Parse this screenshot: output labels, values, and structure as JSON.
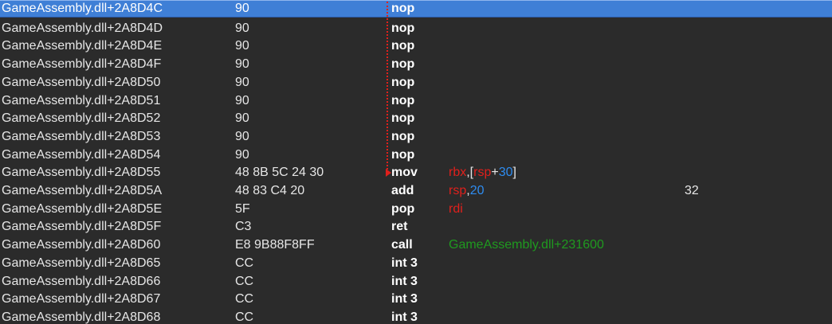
{
  "rows": [
    {
      "addr": "GameAssembly.dll+2A8D4C",
      "bytes": "90",
      "op": "nop",
      "args": [],
      "comment": ""
    },
    {
      "addr": "GameAssembly.dll+2A8D4D",
      "bytes": "90",
      "op": "nop",
      "args": [],
      "comment": ""
    },
    {
      "addr": "GameAssembly.dll+2A8D4E",
      "bytes": "90",
      "op": "nop",
      "args": [],
      "comment": ""
    },
    {
      "addr": "GameAssembly.dll+2A8D4F",
      "bytes": "90",
      "op": "nop",
      "args": [],
      "comment": ""
    },
    {
      "addr": "GameAssembly.dll+2A8D50",
      "bytes": "90",
      "op": "nop",
      "args": [],
      "comment": ""
    },
    {
      "addr": "GameAssembly.dll+2A8D51",
      "bytes": "90",
      "op": "nop",
      "args": [],
      "comment": ""
    },
    {
      "addr": "GameAssembly.dll+2A8D52",
      "bytes": "90",
      "op": "nop",
      "args": [],
      "comment": ""
    },
    {
      "addr": "GameAssembly.dll+2A8D53",
      "bytes": "90",
      "op": "nop",
      "args": [],
      "comment": ""
    },
    {
      "addr": "GameAssembly.dll+2A8D54",
      "bytes": "90",
      "op": "nop",
      "args": [],
      "comment": ""
    },
    {
      "addr": "GameAssembly.dll+2A8D55",
      "bytes": "48 8B 5C 24 30",
      "op": "mov",
      "args": [
        {
          "t": "rbx",
          "k": "reg"
        },
        {
          "t": ",[",
          "k": "punc"
        },
        {
          "t": "rsp",
          "k": "reg"
        },
        {
          "t": "+",
          "k": "punc"
        },
        {
          "t": "30",
          "k": "num"
        },
        {
          "t": "]",
          "k": "punc"
        }
      ],
      "comment": ""
    },
    {
      "addr": "GameAssembly.dll+2A8D5A",
      "bytes": "48 83 C4 20",
      "op": "add",
      "args": [
        {
          "t": "rsp",
          "k": "reg"
        },
        {
          "t": ",",
          "k": "punc"
        },
        {
          "t": "20",
          "k": "num"
        }
      ],
      "comment": "32"
    },
    {
      "addr": "GameAssembly.dll+2A8D5E",
      "bytes": "5F",
      "op": "pop",
      "args": [
        {
          "t": "rdi",
          "k": "reg"
        }
      ],
      "comment": ""
    },
    {
      "addr": "GameAssembly.dll+2A8D5F",
      "bytes": "C3",
      "op": "ret",
      "args": [],
      "comment": ""
    },
    {
      "addr": "GameAssembly.dll+2A8D60",
      "bytes": "E8 9B88F8FF",
      "op": "call",
      "args": [
        {
          "t": "GameAssembly.dll+231600",
          "k": "sym"
        }
      ],
      "comment": ""
    },
    {
      "addr": "GameAssembly.dll+2A8D65",
      "bytes": "CC",
      "op": "int 3",
      "args": [],
      "comment": ""
    },
    {
      "addr": "GameAssembly.dll+2A8D66",
      "bytes": "CC",
      "op": "int 3",
      "args": [],
      "comment": ""
    },
    {
      "addr": "GameAssembly.dll+2A8D67",
      "bytes": "CC",
      "op": "int 3",
      "args": [],
      "comment": ""
    },
    {
      "addr": "GameAssembly.dll+2A8D68",
      "bytes": "CC",
      "op": "int 3",
      "args": [],
      "comment": ""
    }
  ],
  "selected_row": 0,
  "colors": {
    "background": "#2b2b2b",
    "selection": "#3f7fd6",
    "register": "#e0201c",
    "number": "#2e8cf0",
    "symbol": "#1f9a1f",
    "jump_line": "#e0201c"
  },
  "jump": {
    "from_row": 0,
    "to_row": 9
  }
}
